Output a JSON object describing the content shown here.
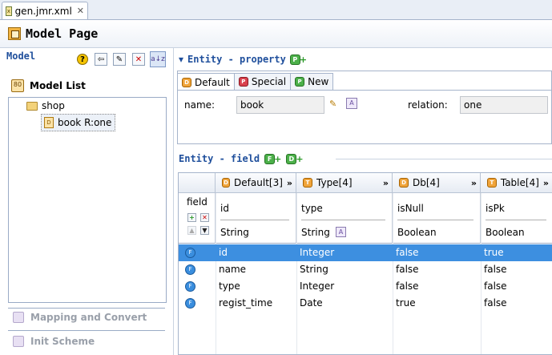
{
  "editor_tab": {
    "title": "gen.jmr.xml",
    "close": "✕"
  },
  "header": {
    "title": "Model Page"
  },
  "left_panel": {
    "section_label": "Model",
    "model_list_title": "Model List",
    "tree": {
      "root": "shop",
      "child": "book R:one"
    },
    "collapsed_sections": [
      "Mapping and Convert",
      "Init Scheme"
    ]
  },
  "entity_property": {
    "title": "Entity - property",
    "add_icon_letter": "P",
    "tabs": [
      {
        "label": "Default",
        "badge": "D",
        "active": true
      },
      {
        "label": "Special",
        "badge": "P",
        "active": false
      },
      {
        "label": "New",
        "badge": "P",
        "active": false
      }
    ],
    "name_label": "name:",
    "name_value": "book",
    "relation_label": "relation:",
    "relation_value": "one"
  },
  "entity_field": {
    "title": "Entity - field",
    "add_icon_letters": [
      "F",
      "D"
    ],
    "corner_label": "field",
    "columns": [
      {
        "header": "Default[3]",
        "name": "id",
        "type": "String"
      },
      {
        "header": "Type[4]",
        "name": "type",
        "type": "String"
      },
      {
        "header": "Db[4]",
        "name": "isNull",
        "type": "Boolean"
      },
      {
        "header": "Table[4]",
        "name": "isPk",
        "type": "Boolean"
      }
    ],
    "rows": [
      {
        "cells": [
          "id",
          "Integer",
          "false",
          "true"
        ],
        "selected": true
      },
      {
        "cells": [
          "name",
          "String",
          "false",
          "false"
        ],
        "selected": false
      },
      {
        "cells": [
          "type",
          "Integer",
          "false",
          "false"
        ],
        "selected": false
      },
      {
        "cells": [
          "regist_time",
          "Date",
          "true",
          "false"
        ],
        "selected": false
      }
    ]
  },
  "colors": {
    "accent": "#1f4f9c",
    "selection": "#3d8fe0"
  }
}
